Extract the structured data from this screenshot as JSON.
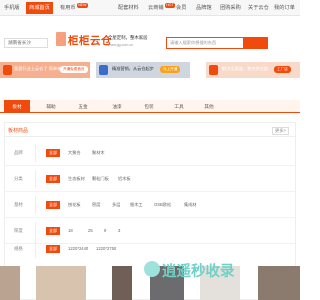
{
  "topnav": {
    "items": [
      {
        "label": "手机版"
      },
      {
        "label": "商城首页"
      },
      {
        "label": "有用币",
        "badge": "NEW"
      },
      {
        "label": "配套材料"
      },
      {
        "label": "云商铺",
        "badge": "HOT"
      },
      {
        "label": "会员"
      },
      {
        "label": "品牌馆"
      },
      {
        "label": "团购采购"
      },
      {
        "label": "关于云仓"
      },
      {
        "label": "我的订单"
      }
    ]
  },
  "header": {
    "city_select": "湖南省长沙",
    "logo": "柜柜云仓",
    "slogan_line1": "全屋定制，整木家居",
    "slogan_line2": "www.gg.com.cn",
    "search_placeholder": "请输入搜索你想搜的东西"
  },
  "banners": [
    {
      "text": "家居行业上云仓了 简单来 · 逛起来",
      "chip": "开通免费首页"
    },
    {
      "text": "精准营销，从云仓起步",
      "chip": "马上开通"
    },
    {
      "text": "解决全渠道，整合供应链",
      "chip": "工厂店"
    }
  ],
  "categories": [
    "板材",
    "辅助",
    "五金",
    "油漆",
    "包装",
    "工具",
    "其他"
  ],
  "card": {
    "title": "板材商品",
    "link": "更多>"
  },
  "filters": [
    {
      "label": "品牌",
      "all": "全部",
      "options": [
        "大聚合",
        "聚材木"
      ]
    },
    {
      "label": "分类",
      "all": "全部",
      "options": [
        "生态板材",
        "颗粒门板",
        "铝木板"
      ]
    },
    {
      "label": "基材",
      "all": "全部",
      "options": [
        "刨花板",
        "密度",
        "多层",
        "细木工",
        "OSB欧松",
        "集成材"
      ]
    },
    {
      "label": "厚度",
      "all": "全部",
      "options": [
        "18",
        "25",
        "9",
        "3"
      ]
    },
    {
      "label": "规格",
      "all": "全部",
      "options": [
        "1220*2440",
        "1220*2750"
      ]
    }
  ],
  "watermark": "逍遥秒收录"
}
